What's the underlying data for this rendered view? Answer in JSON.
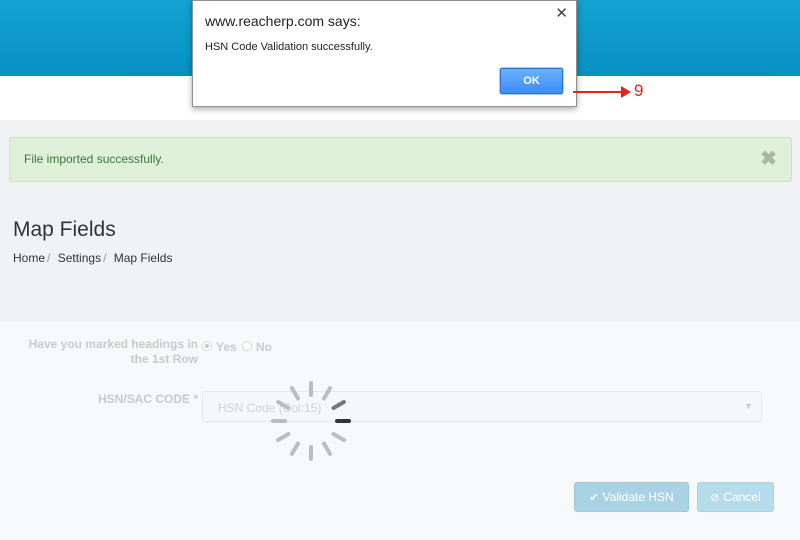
{
  "alert": {
    "message": "File imported successfully.",
    "close_glyph": "✖"
  },
  "page": {
    "title": "Map Fields"
  },
  "breadcrumb": [
    {
      "label": "Home",
      "sep": "/"
    },
    {
      "label": "Settings",
      "sep": "/"
    },
    {
      "label": "Map Fields"
    }
  ],
  "form": {
    "heading_question": "Have you marked headings in the 1st Row",
    "option_yes": "Yes",
    "option_no": "No",
    "hsn_label": "HSN/SAC CODE *",
    "hsn_value": "HSN Code (Col:15)",
    "caret": "▼"
  },
  "buttons": {
    "validate_label": "Validate HSN",
    "validate_icon": "✔",
    "cancel_label": "Cancel",
    "cancel_icon": "⊘"
  },
  "dialog": {
    "title": "www.reacherp.com says:",
    "message": "HSN Code Validation successfully.",
    "ok_label": "OK",
    "close_glyph": "✕"
  },
  "annotation": {
    "number": "9",
    "color": "#e8221b"
  },
  "colors": {
    "header_blue": "#0790c4",
    "alert_bg": "#dff0d8",
    "alert_text": "#3c763d",
    "ok_blue": "#3c8ef5",
    "button_disabled": "#a9d2e5"
  }
}
